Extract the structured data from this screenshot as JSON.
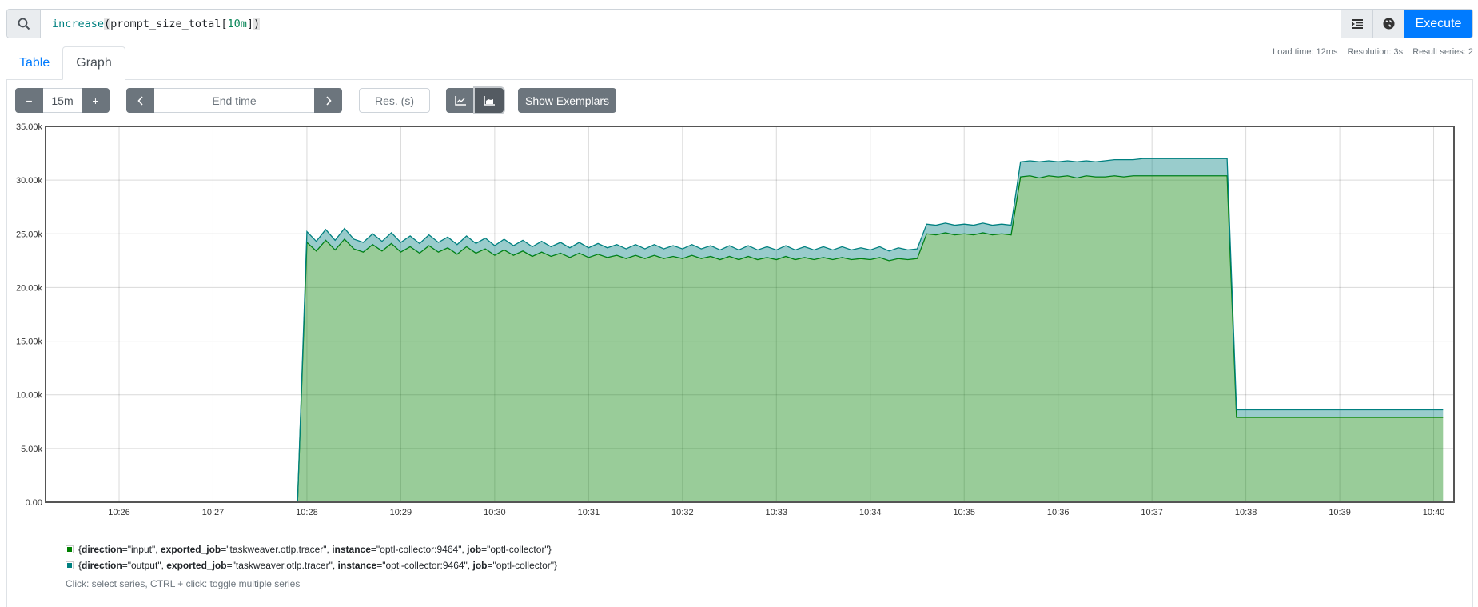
{
  "query": {
    "search_icon": "search-icon",
    "tokens": [
      {
        "text": "increase",
        "kind": "fn"
      },
      {
        "text": "(",
        "kind": "br"
      },
      {
        "text": "prompt_size_total[",
        "kind": "plain"
      },
      {
        "text": "10m",
        "kind": "num"
      },
      {
        "text": "]",
        "kind": "plain"
      },
      {
        "text": ")",
        "kind": "br"
      }
    ],
    "format_icon": "format-indent-icon",
    "metrics_explorer_icon": "globe-icon",
    "execute_label": "Execute"
  },
  "stats": {
    "load_time": "Load time: 12ms",
    "resolution": "Resolution: 3s",
    "result_series": "Result series: 2"
  },
  "tabs": [
    {
      "label": "Table",
      "active": false
    },
    {
      "label": "Graph",
      "active": true
    }
  ],
  "controls": {
    "range_minus": "−",
    "range_value": "15m",
    "range_plus": "+",
    "prev": "‹",
    "end_time_placeholder": "End time",
    "next": "›",
    "resolution_placeholder": "Res. (s)",
    "line_chart_icon": "line-chart-icon",
    "stacked_chart_icon": "stacked-area-chart-icon",
    "stacked_selected": true,
    "show_exemplars": "Show Exemplars"
  },
  "chart_data": {
    "type": "area",
    "stacked": true,
    "title": "",
    "xlabel": "",
    "ylabel": "",
    "ylim": [
      0,
      35000
    ],
    "y_ticks": [
      "0.00",
      "5.00k",
      "10.00k",
      "15.00k",
      "20.00k",
      "25.00k",
      "30.00k",
      "35.00k"
    ],
    "y_tick_values": [
      0,
      5000,
      10000,
      15000,
      20000,
      25000,
      30000,
      35000
    ],
    "x_range": [
      "10:25:13",
      "10:40:13"
    ],
    "x_ticks": [
      "10:26",
      "10:27",
      "10:28",
      "10:29",
      "10:30",
      "10:31",
      "10:32",
      "10:33",
      "10:34",
      "10:35",
      "10:36",
      "10:37",
      "10:38",
      "10:39",
      "10:40"
    ],
    "grid": true,
    "x_start": "10:27:06",
    "x_step_seconds": 6,
    "series": [
      {
        "name": "{direction=\"input\", exported_job=\"taskweaver.otlp.tracer\", instance=\"optl-collector:9464\", job=\"optl-collector\"}",
        "color": "#008000",
        "values": [
          0,
          0,
          0,
          0,
          0,
          0,
          0,
          0,
          0,
          24200,
          23400,
          24400,
          23500,
          24500,
          23600,
          23300,
          24000,
          23400,
          24100,
          23300,
          23800,
          23200,
          23900,
          23300,
          23700,
          23100,
          23800,
          23200,
          23600,
          23000,
          23500,
          23000,
          23400,
          22900,
          23300,
          22900,
          23200,
          22800,
          23200,
          22800,
          23100,
          22800,
          23000,
          22700,
          23000,
          22700,
          23000,
          22700,
          22900,
          22700,
          23000,
          22700,
          22900,
          22600,
          22900,
          22600,
          22900,
          22600,
          22800,
          22600,
          22900,
          22600,
          22800,
          22600,
          22800,
          22600,
          22800,
          22600,
          22700,
          22600,
          22800,
          22500,
          22700,
          22600,
          22700,
          25000,
          24900,
          25100,
          24900,
          25000,
          24900,
          25100,
          24900,
          25000,
          24900,
          30300,
          30400,
          30200,
          30400,
          30300,
          30400,
          30200,
          30400,
          30300,
          30300,
          30400,
          30300,
          30400,
          30400,
          30400,
          30400,
          30400,
          30400,
          30400,
          30400,
          30400,
          30400,
          30400,
          7900,
          7900,
          7900,
          7900,
          7900,
          7900,
          7900,
          7900,
          7900,
          7900,
          7900,
          7900,
          7900,
          7900,
          7900,
          7900,
          7900,
          7900,
          7900,
          7900,
          7900,
          7900,
          7900
        ]
      },
      {
        "name": "{direction=\"output\", exported_job=\"taskweaver.otlp.tracer\", instance=\"optl-collector:9464\", job=\"optl-collector\"}",
        "color": "#008080",
        "values": [
          0,
          0,
          0,
          0,
          0,
          0,
          0,
          0,
          0,
          1000,
          900,
          1000,
          900,
          1000,
          900,
          900,
          1000,
          900,
          1000,
          900,
          1000,
          900,
          1000,
          900,
          1000,
          900,
          1000,
          900,
          1000,
          900,
          1000,
          900,
          1000,
          900,
          1000,
          900,
          1000,
          900,
          1000,
          900,
          1000,
          900,
          1000,
          900,
          1000,
          900,
          1000,
          900,
          1000,
          900,
          1000,
          900,
          1000,
          900,
          1000,
          900,
          1000,
          900,
          1000,
          900,
          1000,
          900,
          1000,
          900,
          1000,
          900,
          1000,
          900,
          1000,
          900,
          1000,
          900,
          1000,
          900,
          900,
          900,
          900,
          900,
          900,
          900,
          900,
          900,
          900,
          900,
          900,
          1400,
          1400,
          1500,
          1400,
          1400,
          1400,
          1500,
          1400,
          1400,
          1500,
          1500,
          1600,
          1500,
          1600,
          1600,
          1600,
          1600,
          1600,
          1600,
          1600,
          1600,
          1600,
          1600,
          700,
          700,
          700,
          700,
          700,
          700,
          700,
          700,
          700,
          700,
          700,
          700,
          700,
          700,
          700,
          700,
          700,
          700,
          700,
          700,
          700,
          700,
          700
        ]
      }
    ],
    "legend_position": "bottom-left"
  },
  "legend": {
    "items": [
      {
        "color": "#008000",
        "parts": [
          [
            "{",
            ""
          ],
          [
            "direction",
            "b"
          ],
          [
            "=\"input\", ",
            ""
          ],
          [
            "exported_job",
            "b"
          ],
          [
            "=\"taskweaver.otlp.tracer\", ",
            ""
          ],
          [
            "instance",
            "b"
          ],
          [
            "=\"optl-collector:9464\", ",
            ""
          ],
          [
            "job",
            "b"
          ],
          [
            "=\"optl-collector\"}",
            ""
          ]
        ]
      },
      {
        "color": "#008080",
        "parts": [
          [
            "{",
            ""
          ],
          [
            "direction",
            "b"
          ],
          [
            "=\"output\", ",
            ""
          ],
          [
            "exported_job",
            "b"
          ],
          [
            "=\"taskweaver.otlp.tracer\", ",
            ""
          ],
          [
            "instance",
            "b"
          ],
          [
            "=\"optl-collector:9464\", ",
            ""
          ],
          [
            "job",
            "b"
          ],
          [
            "=\"optl-collector\"}",
            ""
          ]
        ]
      }
    ],
    "hint": "Click: select series, CTRL + click: toggle multiple series"
  }
}
